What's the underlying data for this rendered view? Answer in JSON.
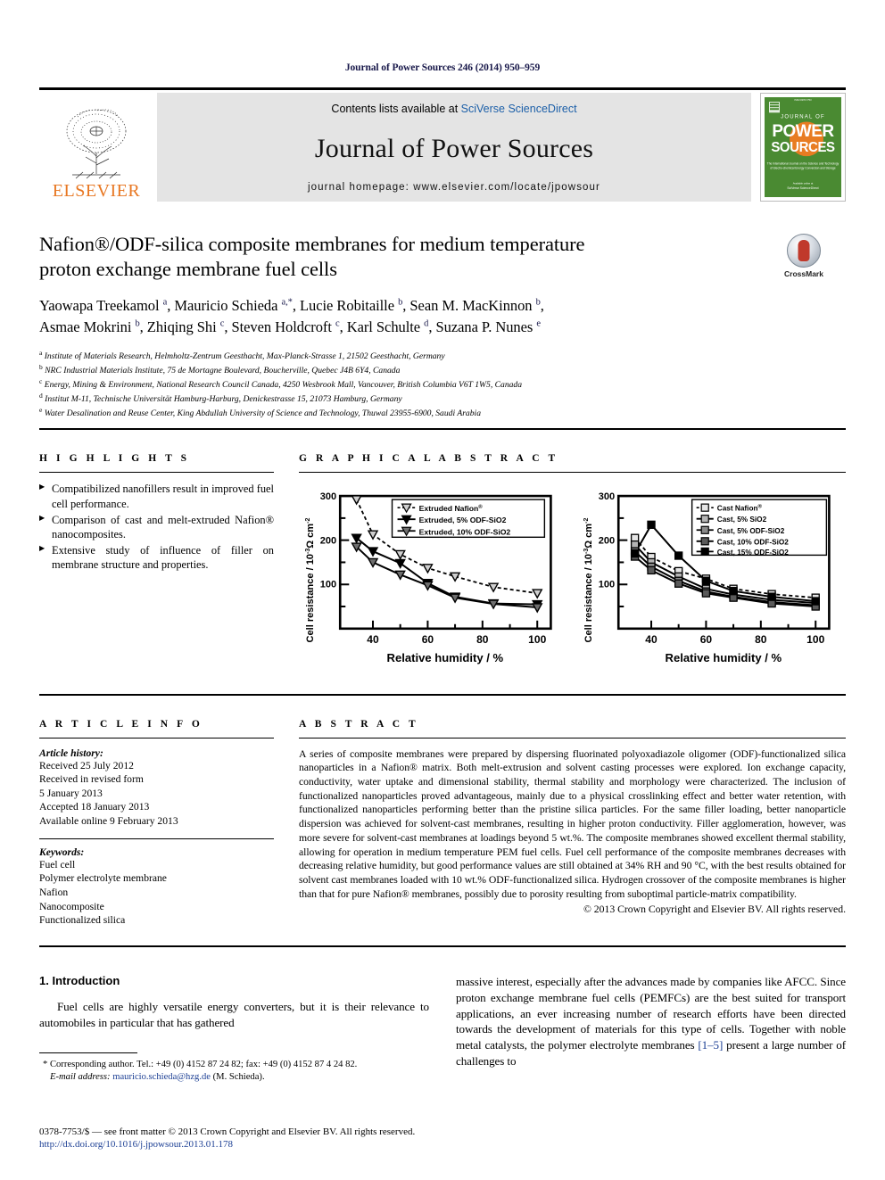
{
  "running_head": "Journal of Power Sources 246 (2014) 950–959",
  "masthead": {
    "contents_prefix": "Contents lists available at ",
    "sciencedirect": "SciVerse ScienceDirect",
    "journal_name": "Journal of Power Sources",
    "homepage": "journal homepage: www.elsevier.com/locate/jpowsour",
    "publisher": "ELSEVIER",
    "cover_title_top": "JOURNAL OF",
    "cover_title_1": "POWER",
    "cover_title_2": "SOURCES"
  },
  "article": {
    "title_line1": "Nafion®/ODF-silica composite membranes for medium temperature",
    "title_line2": "proton exchange membrane fuel cells",
    "crossmark_label": "CrossMark",
    "authors_line1": "Yaowapa Treekamol a, Mauricio Schieda a,*, Lucie Robitaille b, Sean M. MacKinnon b,",
    "authors_line2": "Asmae Mokrini b, Zhiqing Shi c, Steven Holdcroft c, Karl Schulte d, Suzana P. Nunes e",
    "affiliations": [
      "a Institute of Materials Research, Helmholtz-Zentrum Geesthacht, Max-Planck-Strasse 1, 21502 Geesthacht, Germany",
      "b NRC Industrial Materials Institute, 75 de Mortagne Boulevard, Boucherville, Quebec J4B 6Y4, Canada",
      "c Energy, Mining & Environment, National Research Council Canada, 4250 Wesbrook Mall, Vancouver, British Columbia V6T 1W5, Canada",
      "d Institut M-11, Technische Universität Hamburg-Harburg, Denickestrasse 15, 21073 Hamburg, Germany",
      "e Water Desalination and Reuse Center, King Abdullah University of Science and Technology, Thuwal 23955-6900, Saudi Arabia"
    ]
  },
  "highlights": {
    "heading": "H I G H L I G H T S",
    "items": [
      "Compatibilized nanofillers result in improved fuel cell performance.",
      "Comparison of cast and melt-extruded Nafion® nanocomposites.",
      "Extensive study of influence of filler on membrane structure and properties."
    ]
  },
  "graphical_abstract": {
    "heading": "G R A P H I C A L   A B S T R A C T"
  },
  "article_info": {
    "heading": "A R T I C L E   I N F O",
    "history_label": "Article history:",
    "history": [
      "Received 25 July 2012",
      "Received in revised form",
      "5 January 2013",
      "Accepted 18 January 2013",
      "Available online 9 February 2013"
    ],
    "keywords_label": "Keywords:",
    "keywords": [
      "Fuel cell",
      "Polymer electrolyte membrane",
      "Nafion",
      "Nanocomposite",
      "Functionalized silica"
    ]
  },
  "abstract": {
    "heading": "A B S T R A C T",
    "text": "A series of composite membranes were prepared by dispersing fluorinated polyoxadiazole oligomer (ODF)-functionalized silica nanoparticles in a Nafion® matrix. Both melt-extrusion and solvent casting processes were explored. Ion exchange capacity, conductivity, water uptake and dimensional stability, thermal stability and morphology were characterized. The inclusion of functionalized nanoparticles proved advantageous, mainly due to a physical crosslinking effect and better water retention, with functionalized nanoparticles performing better than the pristine silica particles. For the same filler loading, better nanoparticle dispersion was achieved for solvent-cast membranes, resulting in higher proton conductivity. Filler agglomeration, however, was more severe for solvent-cast membranes at loadings beyond 5 wt.%. The composite membranes showed excellent thermal stability, allowing for operation in medium temperature PEM fuel cells. Fuel cell performance of the composite membranes decreases with decreasing relative humidity, but good performance values are still obtained at 34% RH and 90 °C, with the best results obtained for solvent cast membranes loaded with 10 wt.% ODF-functionalized silica. Hydrogen crossover of the composite membranes is higher than that for pure Nafion® membranes, possibly due to porosity resulting from suboptimal particle-matrix compatibility.",
    "copyright": "© 2013 Crown Copyright and Elsevier BV. All rights reserved."
  },
  "introduction": {
    "heading": "1. Introduction",
    "left_paragraph": "Fuel cells are highly versatile energy converters, but it is their relevance to automobiles in particular that has gathered",
    "right_paragraph_pre": "massive interest, especially after the advances made by companies like AFCC. Since proton exchange membrane fuel cells (PEMFCs) are the best suited for transport applications, an ever increasing number of research efforts have been directed towards the development of materials for this type of cells. Together with noble metal catalysts, the polymer electrolyte membranes ",
    "right_citation": "[1–5]",
    "right_paragraph_post": " present a large number of challenges to"
  },
  "footnote": {
    "corresponding": "* Corresponding author. Tel.: +49 (0) 4152 87 24 82; fax: +49 (0) 4152 87 4 24 82.",
    "email_label": "E-mail address:",
    "email": "mauricio.schieda@hzg.de",
    "email_suffix": "(M. Schieda)."
  },
  "publisher_footer": {
    "issn_line": "0378-7753/$ — see front matter © 2013 Crown Copyright and Elsevier BV. All rights reserved.",
    "doi": "http://dx.doi.org/10.1016/j.jpowsour.2013.01.178"
  },
  "chart_data": [
    {
      "type": "line",
      "id": "extruded",
      "title": "",
      "xlabel": "Relative humidity / %",
      "ylabel": "Cell resistance / 10⁻³Ω cm⁻²",
      "xlim": [
        28,
        105
      ],
      "ylim": [
        0,
        300
      ],
      "xticks": [
        40,
        60,
        80,
        100
      ],
      "yticks": [
        100,
        200,
        300
      ],
      "x": [
        34,
        40,
        50,
        60,
        70,
        84,
        100
      ],
      "series": [
        {
          "name": "Extruded Nafion®",
          "marker": "open-down-triangle",
          "line": "dotted",
          "values": [
            292,
            213,
            168,
            137,
            118,
            94,
            80
          ]
        },
        {
          "name": "Extruded, 5% ODF-SiO2",
          "marker": "filled-down-triangle",
          "line": "solid",
          "values": [
            205,
            175,
            148,
            103,
            72,
            57,
            55
          ]
        },
        {
          "name": "Extruded, 10% ODF-SiO2",
          "marker": "half-down-triangle",
          "line": "solid",
          "values": [
            185,
            150,
            122,
            98,
            70,
            56,
            48
          ]
        }
      ]
    },
    {
      "type": "line",
      "id": "cast",
      "title": "",
      "xlabel": "Relative humidity / %",
      "ylabel": "Cell resistance / 10⁻³Ω cm⁻²",
      "xlim": [
        28,
        105
      ],
      "ylim": [
        0,
        300
      ],
      "xticks": [
        40,
        60,
        80,
        100
      ],
      "yticks": [
        100,
        200,
        300
      ],
      "x": [
        34,
        40,
        50,
        60,
        70,
        84,
        100
      ],
      "series": [
        {
          "name": "Cast Nafion®",
          "marker": "open-square",
          "line": "dotted",
          "values": [
            205,
            162,
            130,
            113,
            90,
            78,
            70
          ]
        },
        {
          "name": "Cast, 5% SiO2",
          "marker": "circle-dot-square",
          "line": "solid",
          "values": [
            190,
            150,
            118,
            90,
            77,
            65,
            58
          ]
        },
        {
          "name": "Cast, 5% ODF-SiO2",
          "marker": "half-square",
          "line": "solid",
          "values": [
            175,
            140,
            108,
            84,
            72,
            60,
            53
          ]
        },
        {
          "name": "Cast, 10% ODF-SiO2",
          "marker": "shaded-square",
          "line": "solid",
          "values": [
            163,
            132,
            102,
            80,
            70,
            57,
            50
          ]
        },
        {
          "name": "Cast, 15% ODF-SiO2",
          "marker": "filled-square",
          "line": "solid",
          "values": [
            170,
            235,
            165,
            108,
            85,
            72,
            62
          ]
        }
      ]
    }
  ]
}
